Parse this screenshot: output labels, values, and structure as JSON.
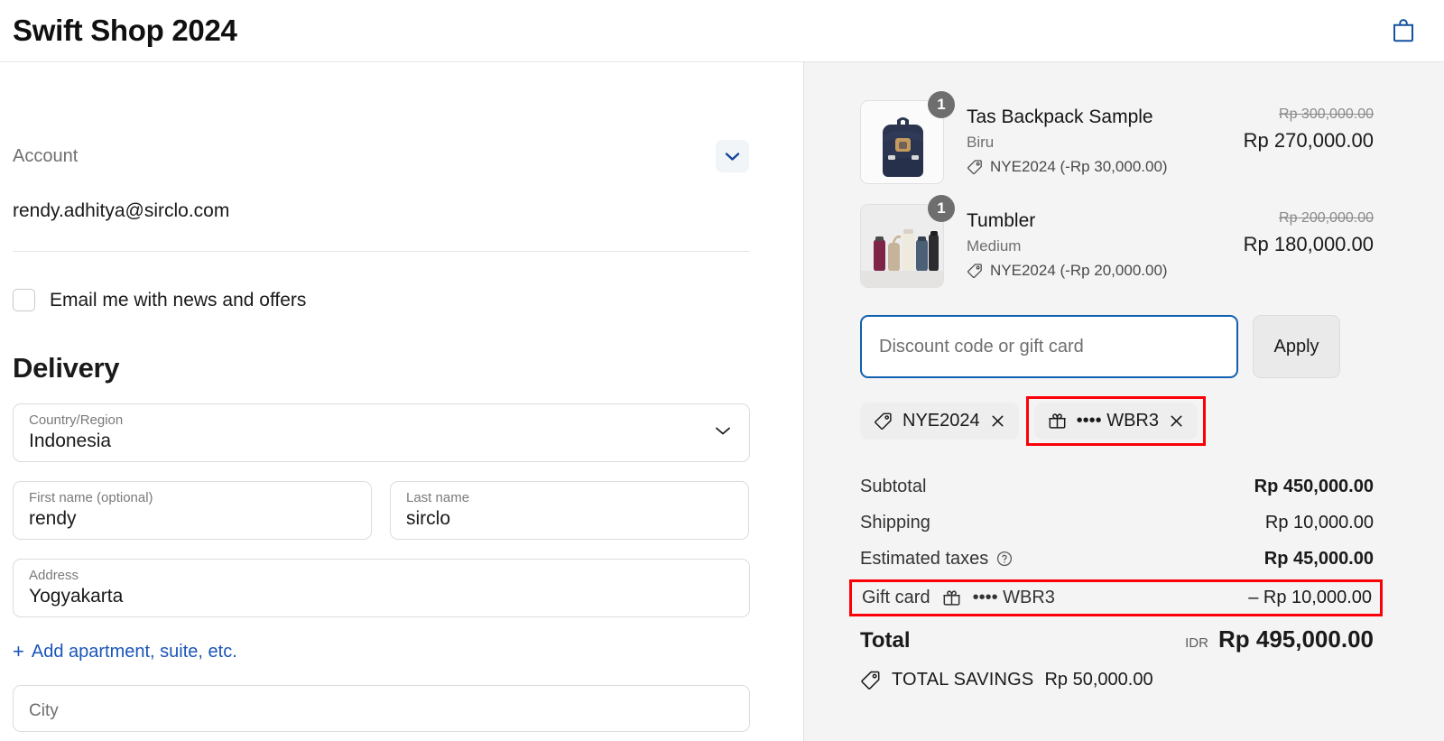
{
  "header": {
    "shop_title": "Swift Shop 2024",
    "cart_icon": "shopping-bag-icon"
  },
  "account": {
    "label": "Account",
    "email": "rendy.adhitya@sirclo.com",
    "chevron_icon": "chevron-down-icon",
    "newsletter_checkbox_label": "Email me with news and offers",
    "newsletter_checked": false
  },
  "delivery": {
    "heading": "Delivery",
    "country": {
      "label": "Country/Region",
      "value": "Indonesia"
    },
    "first_name": {
      "label": "First name (optional)",
      "value": "rendy"
    },
    "last_name": {
      "label": "Last name",
      "value": "sirclo"
    },
    "address": {
      "label": "Address",
      "value": "Yogyakarta"
    },
    "add_apartment_link": "Add apartment, suite, etc.",
    "add_apartment_plus": "+",
    "city": {
      "label": "City",
      "value": ""
    }
  },
  "order_summary": {
    "items": [
      {
        "name": "Tas Backpack Sample",
        "variant": "Biru",
        "quantity": "1",
        "discount_code": "NYE2024",
        "discount_text": "NYE2024 (-Rp 30,000.00)",
        "price_original": "Rp 300,000.00",
        "price_final": "Rp 270,000.00",
        "thumb": "backpack-thumbnail"
      },
      {
        "name": "Tumbler",
        "variant": "Medium",
        "quantity": "1",
        "discount_code": "NYE2024",
        "discount_text": "NYE2024 (-Rp 20,000.00)",
        "price_original": "Rp 200,000.00",
        "price_final": "Rp 180,000.00",
        "thumb": "tumbler-thumbnail"
      }
    ],
    "discount_field": {
      "placeholder": "Discount code or gift card",
      "value": "",
      "apply_label": "Apply",
      "focused": true
    },
    "chips": [
      {
        "icon": "discount-tag-icon",
        "label": "NYE2024",
        "remove_icon": "close-icon",
        "highlighted": false
      },
      {
        "icon": "gift-card-icon",
        "label": "•••• WBR3",
        "remove_icon": "close-icon",
        "highlighted": true
      }
    ],
    "totals": [
      {
        "label": "Subtotal",
        "value": "Rp 450,000.00",
        "bold": true
      },
      {
        "label": "Shipping",
        "value": "Rp 10,000.00",
        "bold": false
      },
      {
        "label": "Estimated taxes",
        "value": "Rp 45,000.00",
        "bold": true,
        "help_icon": "question-circle-icon"
      }
    ],
    "gift_card_line": {
      "label": "Gift card",
      "icon": "gift-card-icon",
      "masked_code": "•••• WBR3",
      "value": "– Rp 10,000.00",
      "highlighted": true
    },
    "grand_total": {
      "label": "Total",
      "currency": "IDR",
      "amount": "Rp 495,000.00"
    },
    "savings": {
      "icon": "discount-tag-icon",
      "label": "TOTAL SAVINGS",
      "amount": "Rp 50,000.00"
    }
  },
  "colors": {
    "accent_blue": "#1a56b8",
    "focus_blue": "#1060b0",
    "annotation_red": "#fb0007",
    "panel_gray": "#f4f4f4",
    "badge_gray": "#6e6e6e"
  }
}
